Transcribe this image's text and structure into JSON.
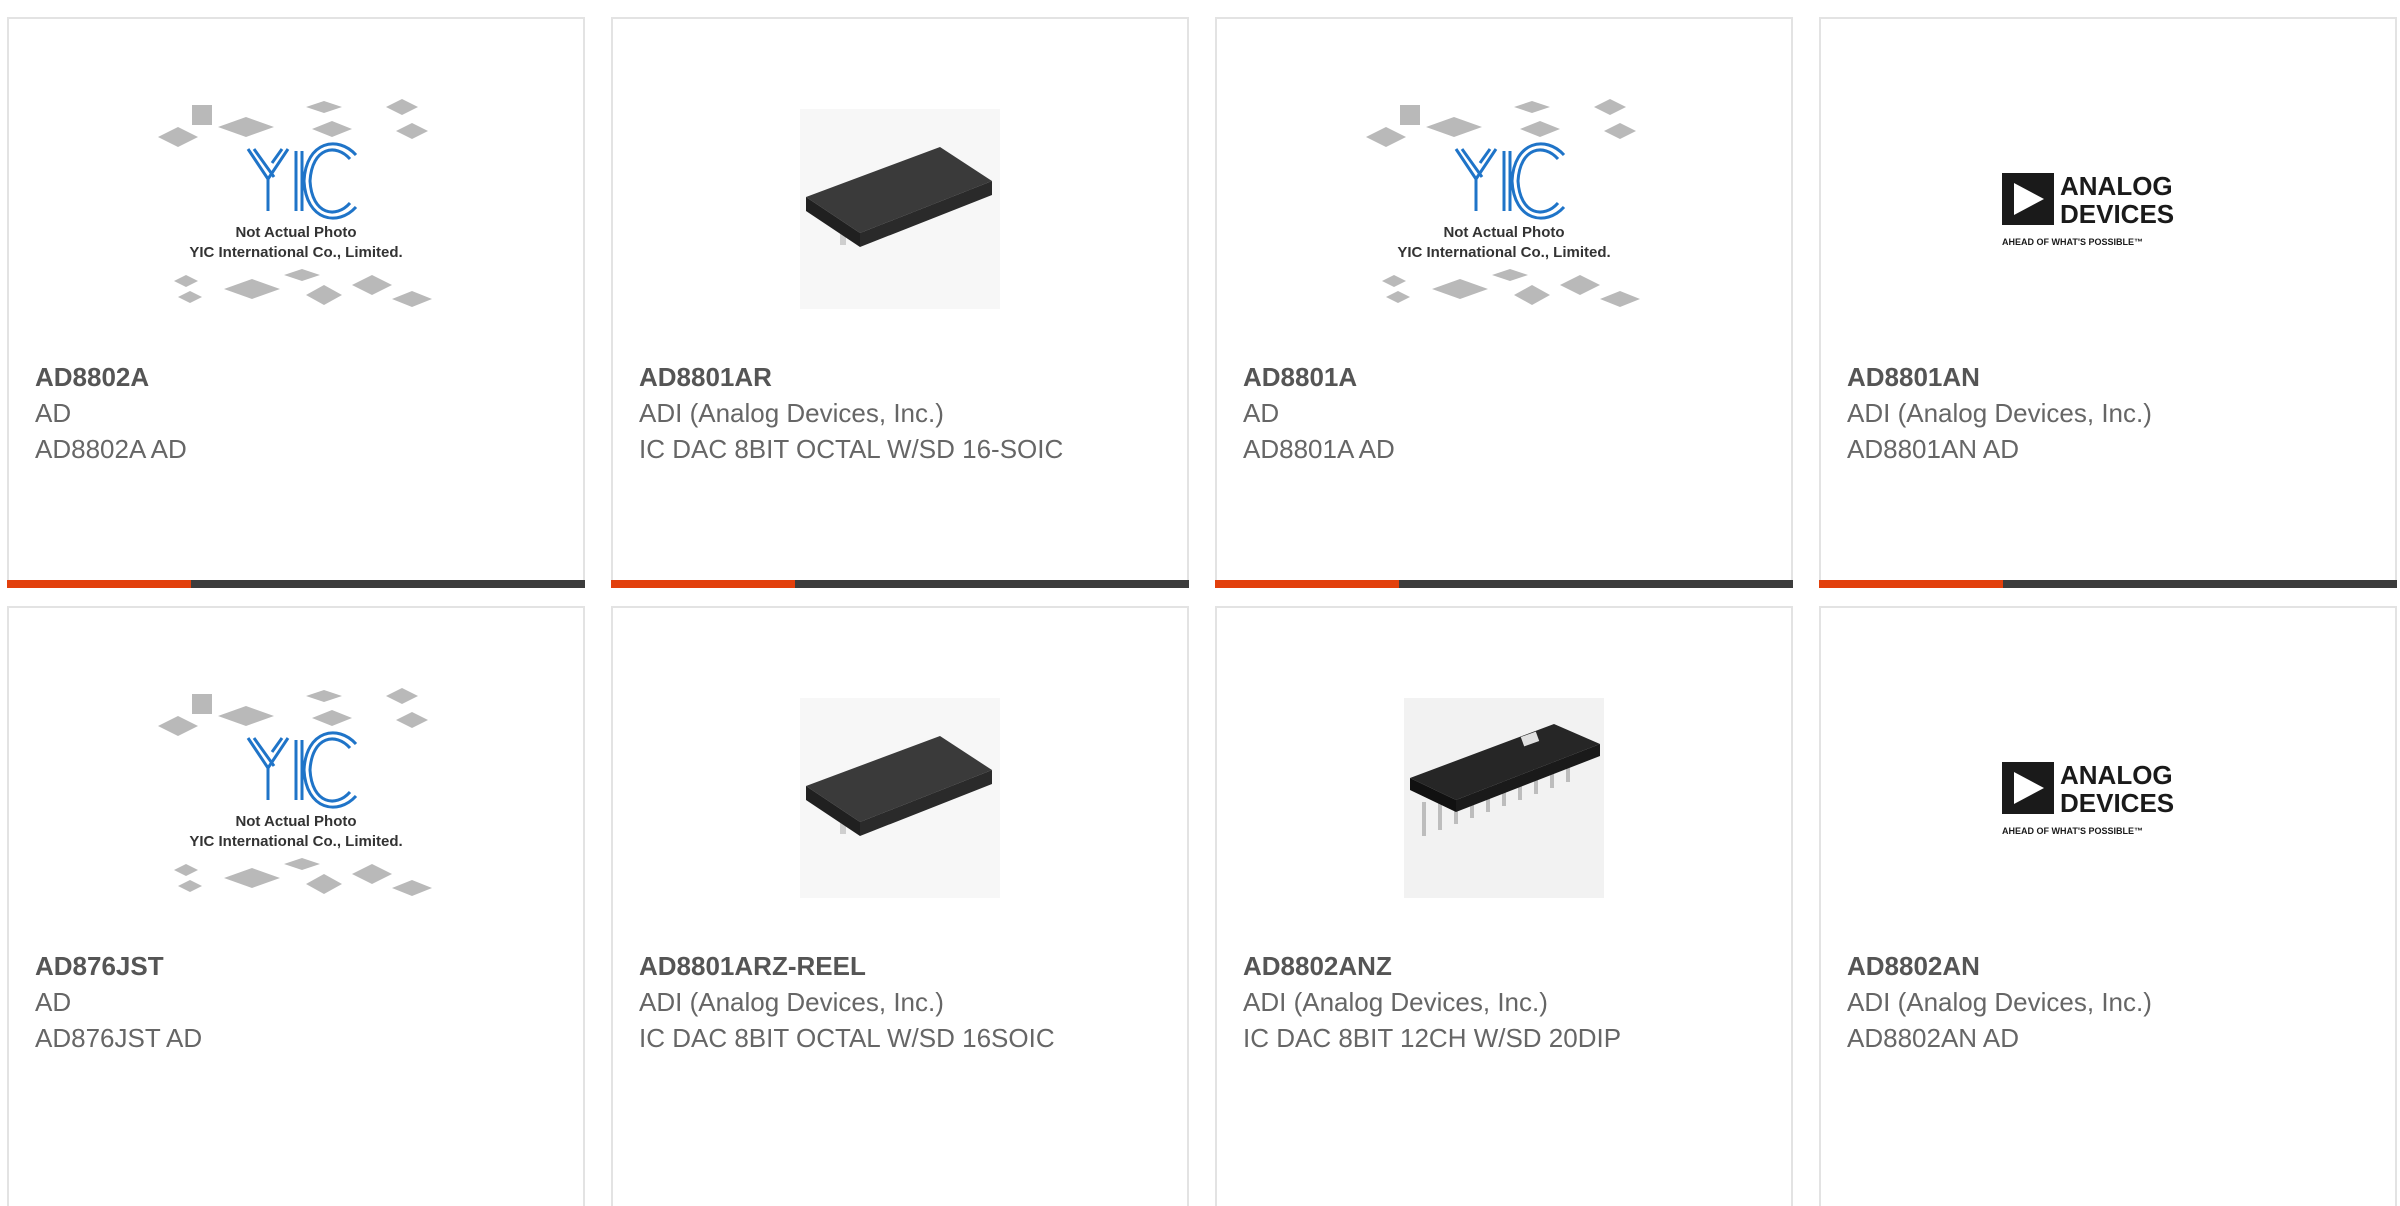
{
  "colors": {
    "accent": "#e2400c",
    "bar": "#3c3c3c",
    "border": "#e3e3e3",
    "text_bold": "#555555",
    "text": "#666666"
  },
  "placeholder": {
    "line1": "Not Actual Photo",
    "line2": "YIC International Co., Limited.",
    "logo": "YIC"
  },
  "adi_logo": {
    "line1": "ANALOG",
    "line2": "DEVICES",
    "tagline": "AHEAD OF WHAT'S POSSIBLE™"
  },
  "products": [
    {
      "part": "AD8802A",
      "manufacturer": "AD",
      "description": "AD8802A AD",
      "image": "yic-placeholder-image"
    },
    {
      "part": "AD8801AR",
      "manufacturer": "ADI (Analog Devices, Inc.)",
      "description": "IC DAC 8BIT OCTAL W/SD 16-SOIC",
      "image": "soic-chip-image"
    },
    {
      "part": "AD8801A",
      "manufacturer": "AD",
      "description": "AD8801A AD",
      "image": "yic-placeholder-image"
    },
    {
      "part": "AD8801AN",
      "manufacturer": "ADI (Analog Devices, Inc.)",
      "description": "AD8801AN AD",
      "image": "analog-devices-logo-image"
    },
    {
      "part": "AD876JST",
      "manufacturer": "AD",
      "description": "AD876JST AD",
      "image": "yic-placeholder-image"
    },
    {
      "part": "AD8801ARZ-REEL",
      "manufacturer": "ADI (Analog Devices, Inc.)",
      "description": "IC DAC 8BIT OCTAL W/SD 16SOIC",
      "image": "soic-chip-image"
    },
    {
      "part": "AD8802ANZ",
      "manufacturer": "ADI (Analog Devices, Inc.)",
      "description": "IC DAC 8BIT 12CH W/SD 20DIP",
      "image": "dip-chip-image"
    },
    {
      "part": "AD8802AN",
      "manufacturer": "ADI (Analog Devices, Inc.)",
      "description": "AD8802AN AD",
      "image": "analog-devices-logo-image"
    }
  ]
}
